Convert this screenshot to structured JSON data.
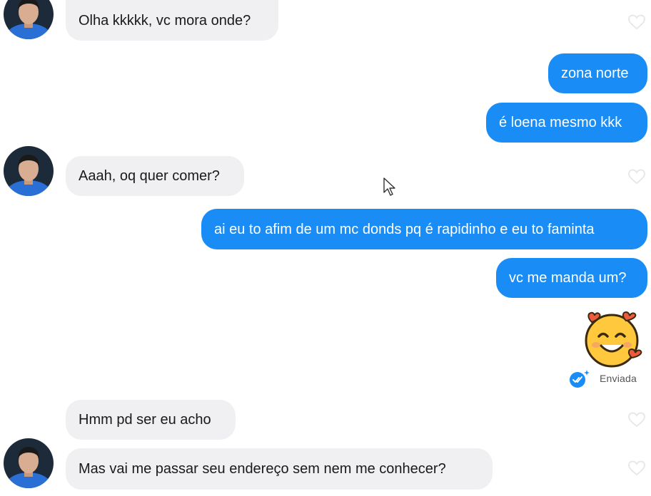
{
  "conversation": {
    "messages": [
      {
        "direction": "incoming",
        "text": "Olha kkkkk, vc mora onde?"
      },
      {
        "direction": "outgoing",
        "text": "zona norte"
      },
      {
        "direction": "outgoing",
        "text": "é loena mesmo kkk"
      },
      {
        "direction": "incoming",
        "text": "Aaah, oq quer comer?"
      },
      {
        "direction": "outgoing",
        "text": "ai eu to afim de um mc donds pq é rapidinho e eu to faminta"
      },
      {
        "direction": "outgoing",
        "text": "vc me manda um?"
      },
      {
        "direction": "outgoing",
        "emoji": "smiling-face-with-hearts"
      },
      {
        "direction": "incoming",
        "text": "Hmm pd ser eu acho"
      },
      {
        "direction": "incoming",
        "text": "Mas vai me passar seu endereço sem nem me conhecer?"
      }
    ],
    "sent_status": "Enviada"
  },
  "colors": {
    "outgoing_bubble": "#1a8cf5",
    "incoming_bubble": "#f0f0f2",
    "status_check": "#1a8cf5"
  },
  "icons": {
    "like": "heart-outline-icon",
    "sent": "double-check-sent-icon",
    "avatar": "contact-avatar"
  }
}
